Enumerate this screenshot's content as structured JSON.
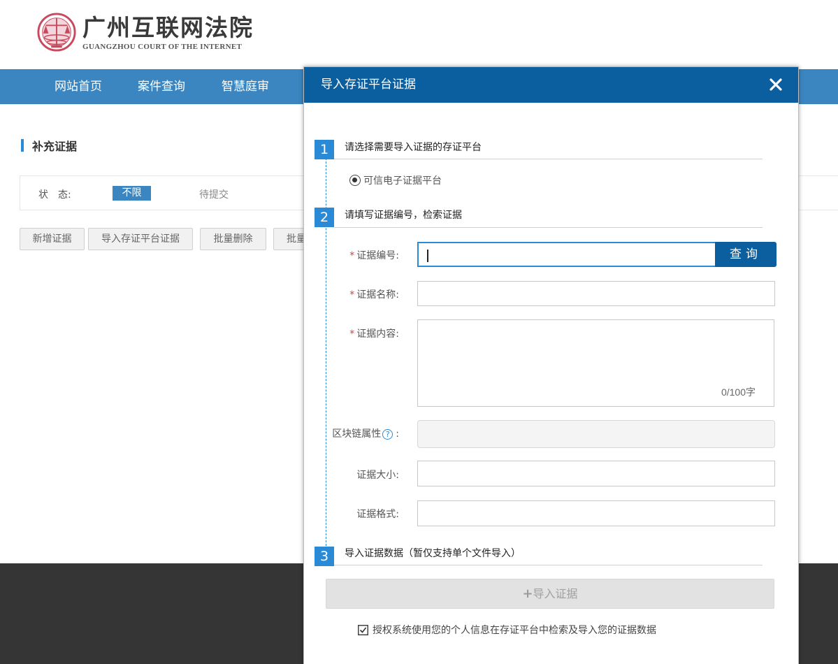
{
  "site": {
    "name_cn": "广州互联网法院",
    "name_en": "GUANGZHOU COURT OF THE INTERNET"
  },
  "nav": {
    "items": [
      "网站首页",
      "案件查询",
      "智慧庭审"
    ]
  },
  "page": {
    "section_title": "补充证据",
    "filter": {
      "label": "状　态:",
      "options": [
        "不限",
        "待提交"
      ],
      "selected": "不限"
    },
    "buttons": [
      "新增证据",
      "导入存证平台证据",
      "批量删除",
      "批量"
    ]
  },
  "modal": {
    "title": "导入存证平台证据",
    "close_icon": "close-icon",
    "steps": [
      {
        "num": "1",
        "title": "请选择需要导入证据的存证平台"
      },
      {
        "num": "2",
        "title": "请填写证据编号，检索证据"
      },
      {
        "num": "3",
        "title": "导入证据数据（暂仅支持单个文件导入）"
      }
    ],
    "platform_option": "可信电子证据平台",
    "fields": {
      "evidence_no": {
        "label": "证据编号:",
        "value": ""
      },
      "evidence_name": {
        "label": "证据名称:",
        "value": ""
      },
      "evidence_content": {
        "label": "证据内容:",
        "value": "",
        "counter": "0/100字"
      },
      "blockchain": {
        "label": "区块链属性",
        "suffix": ":",
        "value": ""
      },
      "size": {
        "label": "证据大小:",
        "value": ""
      },
      "format": {
        "label": "证据格式:",
        "value": ""
      }
    },
    "required_mark": "*",
    "search_label": "查询",
    "import_label": "导入证据",
    "import_plus": "+",
    "auth_text": "授权系统使用您的个人信息在存证平台中检索及导入您的证据数据",
    "auth_checked": true
  },
  "colors": {
    "nav_bg": "#3b86c0",
    "modal_header": "#0c5f9f",
    "accent": "#2b8ad6",
    "required": "#e03c31",
    "footer": "#353535"
  }
}
